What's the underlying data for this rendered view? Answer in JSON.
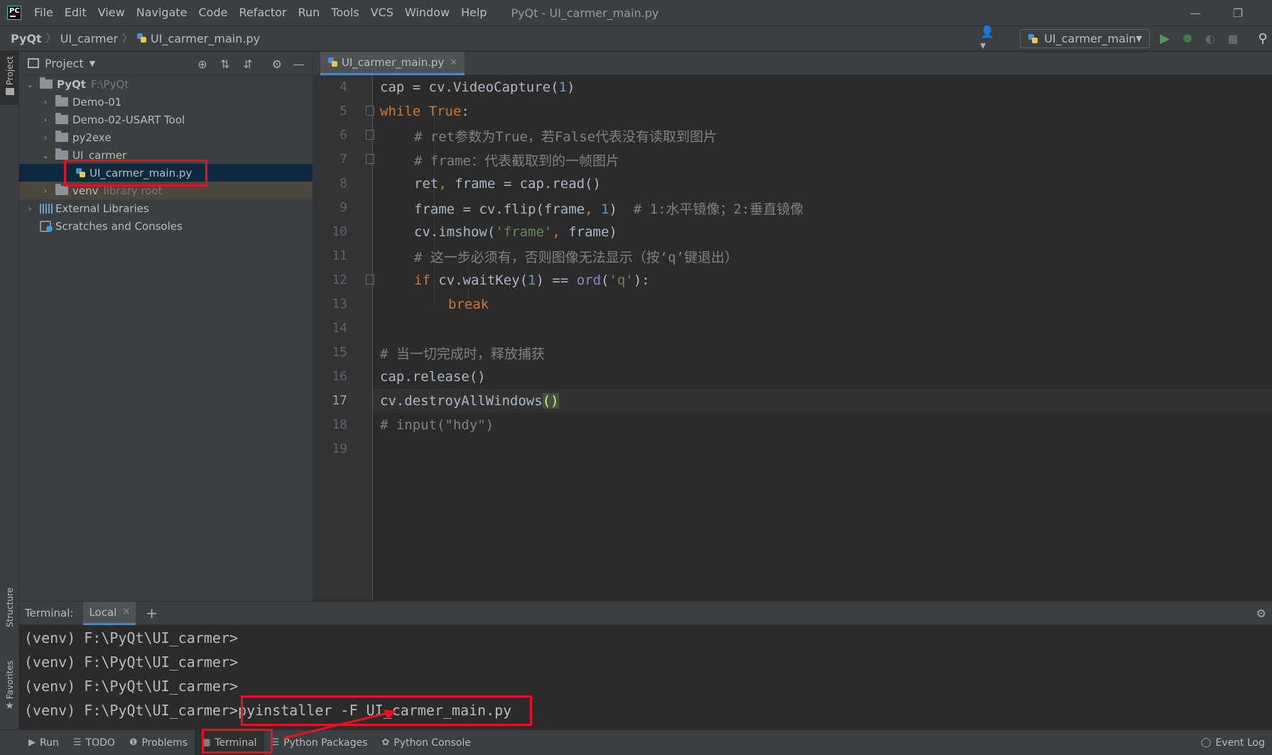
{
  "menubar": {
    "items": [
      {
        "label": "File"
      },
      {
        "label": "Edit"
      },
      {
        "label": "View"
      },
      {
        "label": "Navigate"
      },
      {
        "label": "Code"
      },
      {
        "label": "Refactor"
      },
      {
        "label": "Run"
      },
      {
        "label": "Tools"
      },
      {
        "label": "VCS"
      },
      {
        "label": "Window"
      },
      {
        "label": "Help"
      }
    ],
    "window_title": "PyQt - UI_carmer_main.py"
  },
  "navbar": {
    "crumbs": [
      "PyQt",
      "UI_carmer",
      "UI_carmer_main.py"
    ],
    "run_config": "UI_carmer_main"
  },
  "left_strip": {
    "project": "Project",
    "structure": "Structure",
    "favorites": "Favorites"
  },
  "project_panel": {
    "title": "Project",
    "tree": [
      {
        "label": "PyQt",
        "hint": "F:\\PyQt"
      },
      {
        "label": "Demo-01"
      },
      {
        "label": "Demo-02-USART Tool"
      },
      {
        "label": "py2exe"
      },
      {
        "label": "UI_carmer"
      },
      {
        "label": "UI_carmer_main.py"
      },
      {
        "label": "venv",
        "hint": "library root"
      },
      {
        "label": "External Libraries"
      },
      {
        "label": "Scratches and Consoles"
      }
    ]
  },
  "editor": {
    "tab_label": "UI_carmer_main.py",
    "line_numbers": [
      "4",
      "5",
      "6",
      "7",
      "8",
      "9",
      "10",
      "11",
      "12",
      "13",
      "14",
      "15",
      "16",
      "17",
      "18",
      "19"
    ],
    "lines": {
      "l4": {
        "a": "cap = cv.VideoCapture(",
        "b": "1",
        "c": ")"
      },
      "l5": {
        "a": "while",
        "b": " ",
        "c": "True",
        "d": ":"
      },
      "l6": "# ret参数为True，若False代表没有读取到图片",
      "l7": "# frame：代表截取到的一帧图片",
      "l8": {
        "a": "ret",
        "b": ", ",
        "c": "frame = cap.read()"
      },
      "l9": {
        "a": "frame = cv.flip(frame",
        "b": ", ",
        "c": "1",
        "d": ")  ",
        "e": "# 1:水平镜像；2:垂直镜像"
      },
      "l10": {
        "a": "cv.imshow(",
        "b": "'frame'",
        "c": ", ",
        "d": "frame)"
      },
      "l11": "# 这一步必须有，否则图像无法显示（按‘q’键退出）",
      "l12": {
        "a": "if",
        "b": " cv.waitKey(",
        "c": "1",
        "d": ") == ",
        "e": "ord",
        "f": "(",
        "g": "'q'",
        "h": "):"
      },
      "l13": "break",
      "l15": "# 当一切完成时，释放捕获",
      "l16": "cap.release()",
      "l17": {
        "a": "cv.destroyAllWindows",
        "b": "()"
      },
      "l18": "# input(\"hdy\")"
    }
  },
  "terminal": {
    "label": "Terminal:",
    "tab": "Local",
    "prompt": "(venv) F:\\PyQt\\UI_carmer>",
    "command": "pyinstaller -F UI_carmer_main.py"
  },
  "statusbar": {
    "items": [
      "Run",
      "TODO",
      "Problems",
      "Terminal",
      "Python Packages",
      "Python Console"
    ],
    "event_log": "Event Log"
  },
  "colors": {
    "highlight_box": "#e81123",
    "keyword": "#cc7832",
    "number": "#6897bb",
    "string": "#6a8759",
    "comment": "#808080"
  }
}
